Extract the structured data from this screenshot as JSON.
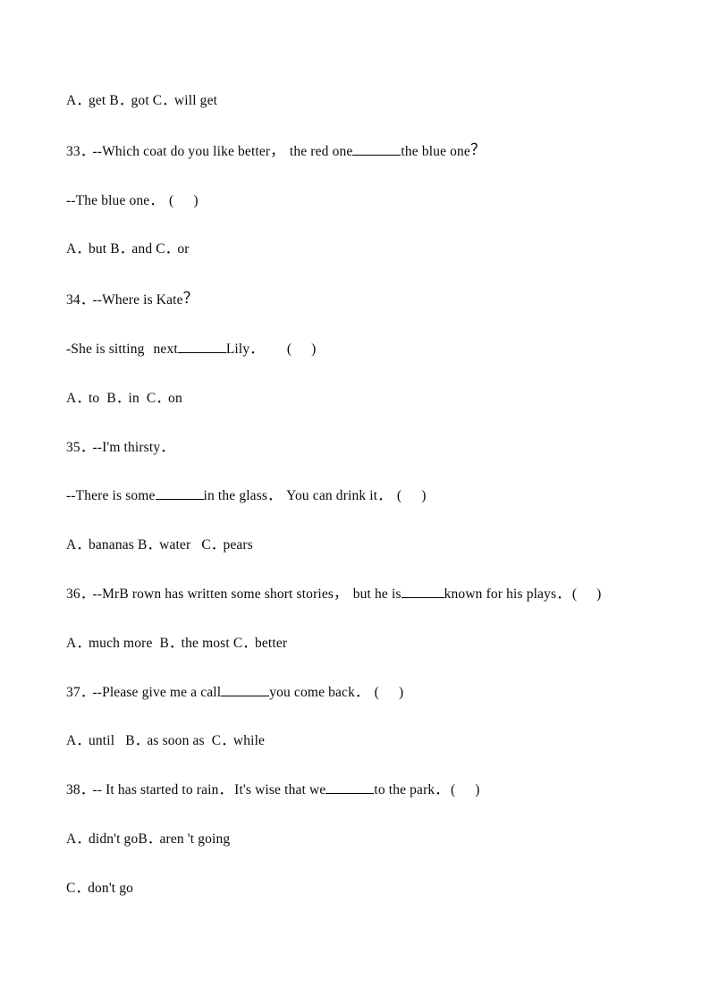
{
  "document": {
    "type": "english-grammar-worksheet",
    "page_background": "#ffffff",
    "text_color": "#000000",
    "blank_marker": "_______",
    "answer_bracket_open": "(",
    "answer_bracket_close": ")",
    "lines": [
      {
        "id": "l1",
        "kind": "options",
        "text": "A． get B． got C． will get"
      },
      {
        "id": "l2",
        "kind": "question-stem",
        "number": "33．",
        "text": "33． --Which coat do you like better，   the red one_______the blue one？"
      },
      {
        "id": "l3",
        "kind": "answer-line",
        "text": "--The blue one．   (     )"
      },
      {
        "id": "l4",
        "kind": "options",
        "text": "A． but B． and C． or"
      },
      {
        "id": "l5",
        "kind": "question-stem",
        "number": "34．",
        "text": "34． --Where is Kate？"
      },
      {
        "id": "l6",
        "kind": "answer-line",
        "text": "-She is sitting  next_______Lily．     (     )"
      },
      {
        "id": "l7",
        "kind": "options",
        "text": "A． to  B． in  C． on"
      },
      {
        "id": "l8",
        "kind": "question-stem",
        "number": "35．",
        "text": "35． --I'm thirsty．"
      },
      {
        "id": "l9",
        "kind": "answer-line",
        "text": "--There is some_______in the glass．   You can drink it．   (     )"
      },
      {
        "id": "l10",
        "kind": "options",
        "text": "A． bananas B． water   C． pears"
      },
      {
        "id": "l11",
        "kind": "question-stem",
        "number": "36．",
        "text": "36． --MrB rown has written some short stories，   but he is______known for his plays．  (     )"
      },
      {
        "id": "l12",
        "kind": "options",
        "text": "A． much more  B． the most C． better"
      },
      {
        "id": "l13",
        "kind": "question-stem",
        "number": "37．",
        "text": "37． --Please give me a call_______you come back．   (     )"
      },
      {
        "id": "l14",
        "kind": "options",
        "text": "A． until   B． as soon as  C． while"
      },
      {
        "id": "l15",
        "kind": "question-stem",
        "number": "38．",
        "text": "38． -- It has started to rain．  It's wise that we_______to the park．  (     )"
      },
      {
        "id": "l16",
        "kind": "options",
        "text": "A． didn't goB． aren 't going"
      },
      {
        "id": "l17",
        "kind": "options",
        "text": "C． don't go"
      }
    ],
    "segments": {
      "l1": [
        {
          "t": "A",
          "s": "txt"
        },
        {
          "t": "．",
          "s": "fw"
        },
        {
          "t": " get B",
          "s": "txt"
        },
        {
          "t": "．",
          "s": "fw"
        },
        {
          "t": " got C",
          "s": "txt"
        },
        {
          "t": "．",
          "s": "fw"
        },
        {
          "t": " will get",
          "s": "txt"
        }
      ],
      "l2": [
        {
          "t": "33",
          "s": "txt"
        },
        {
          "t": "．",
          "s": "fw"
        },
        {
          "t": " --Which coat do you like better",
          "s": "txt"
        },
        {
          "t": "，",
          "s": "fw"
        },
        {
          "t": "   the red one",
          "s": "txt"
        },
        {
          "t": "",
          "s": "blank7"
        },
        {
          "t": "the blue one",
          "s": "txt"
        },
        {
          "t": "？",
          "s": "qmark"
        }
      ],
      "l3": [
        {
          "t": "--The blue one",
          "s": "txt"
        },
        {
          "t": "．",
          "s": "fw"
        },
        {
          "t": "   (",
          "s": "txt"
        },
        {
          "t": "",
          "s": "gapm"
        },
        {
          "t": ")",
          "s": "txt"
        }
      ],
      "l4": [
        {
          "t": "A",
          "s": "txt"
        },
        {
          "t": "．",
          "s": "fw"
        },
        {
          "t": " but B",
          "s": "txt"
        },
        {
          "t": "．",
          "s": "fw"
        },
        {
          "t": " and C",
          "s": "txt"
        },
        {
          "t": "．",
          "s": "fw"
        },
        {
          "t": " or",
          "s": "txt"
        }
      ],
      "l5": [
        {
          "t": "34",
          "s": "txt"
        },
        {
          "t": "．",
          "s": "fw"
        },
        {
          "t": " --Where is Kate",
          "s": "txt"
        },
        {
          "t": "？",
          "s": "qmark"
        }
      ],
      "l6": [
        {
          "t": "-She is sitting",
          "s": "txt"
        },
        {
          "t": "",
          "s": "gaps"
        },
        {
          "t": "next",
          "s": "txt"
        },
        {
          "t": "",
          "s": "blank7"
        },
        {
          "t": "Lily",
          "s": "txt"
        },
        {
          "t": "．",
          "s": "fw"
        },
        {
          "t": "",
          "s": "gapl"
        },
        {
          "t": "(",
          "s": "txt"
        },
        {
          "t": "",
          "s": "gapm"
        },
        {
          "t": ")",
          "s": "txt"
        }
      ],
      "l7": [
        {
          "t": "A",
          "s": "txt"
        },
        {
          "t": "．",
          "s": "fw"
        },
        {
          "t": " to  B",
          "s": "txt"
        },
        {
          "t": "．",
          "s": "fw"
        },
        {
          "t": " in  C",
          "s": "txt"
        },
        {
          "t": "．",
          "s": "fw"
        },
        {
          "t": " on",
          "s": "txt"
        }
      ],
      "l8": [
        {
          "t": "35",
          "s": "txt"
        },
        {
          "t": "．",
          "s": "fw"
        },
        {
          "t": " --I'm thirsty",
          "s": "txt"
        },
        {
          "t": "．",
          "s": "fw"
        }
      ],
      "l9": [
        {
          "t": "--There is some",
          "s": "txt"
        },
        {
          "t": "",
          "s": "blank7"
        },
        {
          "t": "in the glass",
          "s": "txt"
        },
        {
          "t": "．",
          "s": "fw"
        },
        {
          "t": "   You can drink it",
          "s": "txt"
        },
        {
          "t": "．",
          "s": "fw"
        },
        {
          "t": "   (",
          "s": "txt"
        },
        {
          "t": "",
          "s": "gapm"
        },
        {
          "t": ")",
          "s": "txt"
        }
      ],
      "l10": [
        {
          "t": "A",
          "s": "txt"
        },
        {
          "t": "．",
          "s": "fw"
        },
        {
          "t": " bananas B",
          "s": "txt"
        },
        {
          "t": "．",
          "s": "fw"
        },
        {
          "t": " water   C",
          "s": "txt"
        },
        {
          "t": "．",
          "s": "fw"
        },
        {
          "t": " pears",
          "s": "txt"
        }
      ],
      "l11": [
        {
          "t": "36",
          "s": "txt"
        },
        {
          "t": "．",
          "s": "fw"
        },
        {
          "t": " --MrB rown has written some short stories",
          "s": "txt"
        },
        {
          "t": "，",
          "s": "fw"
        },
        {
          "t": "   but he is",
          "s": "txt"
        },
        {
          "t": "",
          "s": "blank6"
        },
        {
          "t": "known for his plays",
          "s": "txt"
        },
        {
          "t": "．",
          "s": "fw"
        },
        {
          "t": "  (",
          "s": "txt"
        },
        {
          "t": "",
          "s": "gapm"
        },
        {
          "t": ")",
          "s": "txt"
        }
      ],
      "l12": [
        {
          "t": "A",
          "s": "txt"
        },
        {
          "t": "．",
          "s": "fw"
        },
        {
          "t": " much more  B",
          "s": "txt"
        },
        {
          "t": "．",
          "s": "fw"
        },
        {
          "t": " the most C",
          "s": "txt"
        },
        {
          "t": "．",
          "s": "fw"
        },
        {
          "t": " better",
          "s": "txt"
        }
      ],
      "l13": [
        {
          "t": "37",
          "s": "txt"
        },
        {
          "t": "．",
          "s": "fw"
        },
        {
          "t": " --Please give me a call",
          "s": "txt"
        },
        {
          "t": "",
          "s": "blank7"
        },
        {
          "t": "you come back",
          "s": "txt"
        },
        {
          "t": "．",
          "s": "fw"
        },
        {
          "t": "   (",
          "s": "txt"
        },
        {
          "t": "",
          "s": "gapm"
        },
        {
          "t": ")",
          "s": "txt"
        }
      ],
      "l14": [
        {
          "t": "A",
          "s": "txt"
        },
        {
          "t": "．",
          "s": "fw"
        },
        {
          "t": " until   B",
          "s": "txt"
        },
        {
          "t": "．",
          "s": "fw"
        },
        {
          "t": " as soon as  C",
          "s": "txt"
        },
        {
          "t": "．",
          "s": "fw"
        },
        {
          "t": " while",
          "s": "txt"
        }
      ],
      "l15": [
        {
          "t": "38",
          "s": "txt"
        },
        {
          "t": "．",
          "s": "fw"
        },
        {
          "t": " -- It has started to rain",
          "s": "txt"
        },
        {
          "t": "．",
          "s": "fw"
        },
        {
          "t": "  It's wise that we",
          "s": "txt"
        },
        {
          "t": "",
          "s": "blank7"
        },
        {
          "t": "to the park",
          "s": "txt"
        },
        {
          "t": "．",
          "s": "fw"
        },
        {
          "t": "  (",
          "s": "txt"
        },
        {
          "t": "",
          "s": "gapm"
        },
        {
          "t": ")",
          "s": "txt"
        }
      ],
      "l16": [
        {
          "t": "A",
          "s": "txt"
        },
        {
          "t": "．",
          "s": "fw"
        },
        {
          "t": " didn't goB",
          "s": "txt"
        },
        {
          "t": "．",
          "s": "fw"
        },
        {
          "t": " aren 't going",
          "s": "txt"
        }
      ],
      "l17": [
        {
          "t": "C",
          "s": "txt"
        },
        {
          "t": "．",
          "s": "fw"
        },
        {
          "t": " don't go",
          "s": "txt"
        }
      ]
    }
  }
}
